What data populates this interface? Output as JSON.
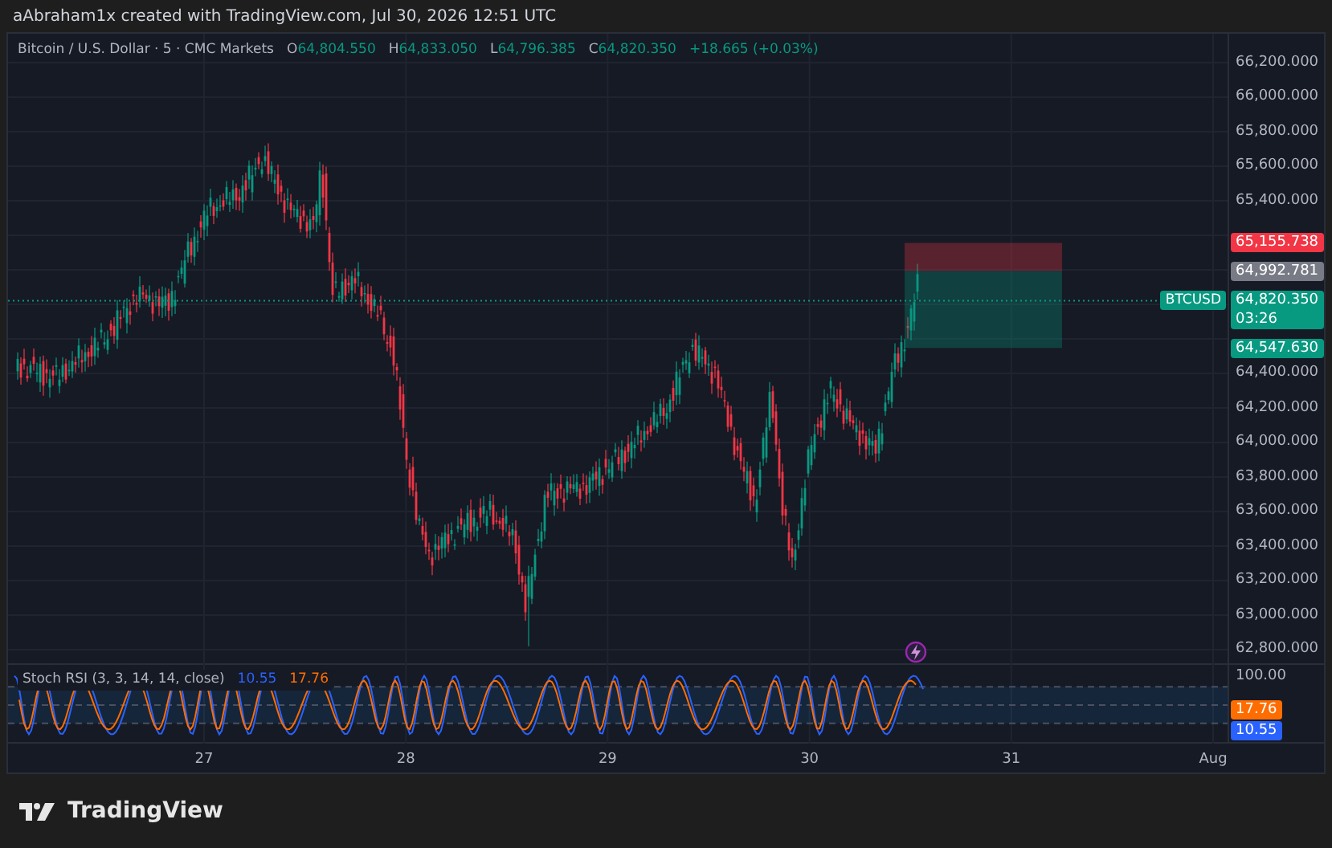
{
  "caption": "aAbraham1x created with TradingView.com, Jul 30, 2026 12:51 UTC",
  "legend": {
    "symbol": "Bitcoin / U.S. Dollar · 5 · CMC Markets",
    "change": "+18.665 (+0.03%)",
    "ohlc": [
      {
        "key": "O",
        "value": "64,804.550"
      },
      {
        "key": "H",
        "value": "64,833.050"
      },
      {
        "key": "L",
        "value": "64,796.385"
      },
      {
        "key": "C",
        "value": "64,820.350"
      }
    ]
  },
  "price_axis": [
    "66,200.000",
    "66,000.000",
    "65,800.000",
    "65,600.000",
    "65,400.000",
    "64,400.000",
    "64,200.000",
    "64,000.000",
    "63,800.000",
    "63,600.000",
    "63,400.000",
    "63,200.000",
    "63,000.000",
    "62,800.000"
  ],
  "price_labels": [
    {
      "kind": "stop",
      "value": "65,155.738",
      "color": "#f23645"
    },
    {
      "kind": "entry",
      "value": "64,992.781",
      "color": "#787b86"
    },
    {
      "kind": "last",
      "symbol": "BTCUSD",
      "value": "64,820.350",
      "countdown": "03:26",
      "color": "#089981"
    },
    {
      "kind": "target",
      "value": "64,547.630",
      "color": "#089981"
    }
  ],
  "stoch": {
    "title": "Stoch RSI (3, 3, 14, 14, close)",
    "axis": "100.00",
    "values": [
      {
        "text": "10.55",
        "color": "#2962ff"
      },
      {
        "text": "17.76",
        "color": "#ff6d00"
      }
    ],
    "badges": [
      {
        "text": "17.76",
        "color": "#ff6d00"
      },
      {
        "text": "10.55",
        "color": "#2962ff"
      }
    ]
  },
  "time_axis": [
    "27",
    "28",
    "29",
    "30",
    "31",
    "Aug"
  ],
  "footer": {
    "brand": "TradingView"
  }
}
